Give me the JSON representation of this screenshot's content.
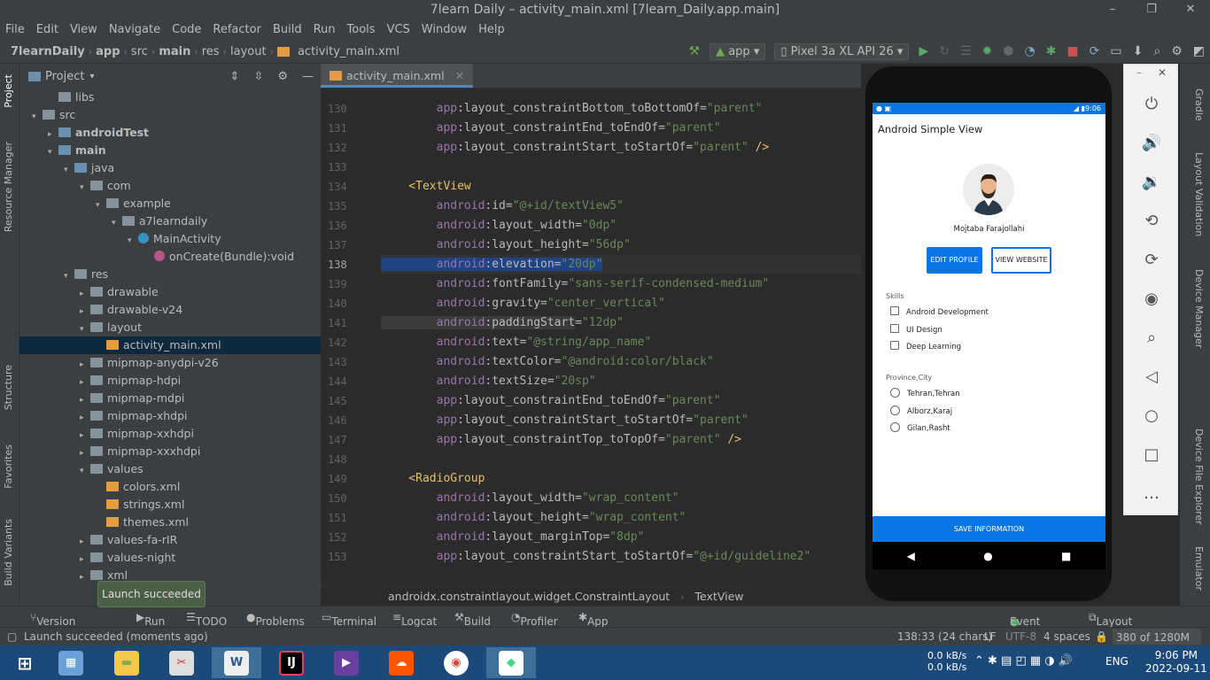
{
  "window": {
    "title": "7learn Daily – activity_main.xml [7learn_Daily.app.main]",
    "minimize": "–",
    "maximize": "❐",
    "close": "✕"
  },
  "menu": [
    "File",
    "Edit",
    "View",
    "Navigate",
    "Code",
    "Refactor",
    "Build",
    "Run",
    "Tools",
    "VCS",
    "Window",
    "Help"
  ],
  "breadcrumbs": [
    "7learnDaily",
    "app",
    "src",
    "main",
    "res",
    "layout",
    "activity_main.xml"
  ],
  "toolbar": {
    "config": "app",
    "device": "Pixel 3a XL API 26"
  },
  "project_panel": {
    "title": "Project",
    "tree": [
      {
        "label": "libs",
        "depth": 3,
        "type": "folder",
        "arrow": ""
      },
      {
        "label": "src",
        "depth": 2,
        "type": "folder",
        "arrow": "▾"
      },
      {
        "label": "androidTest",
        "depth": 3,
        "type": "folder-src",
        "arrow": "▸",
        "bold": true
      },
      {
        "label": "main",
        "depth": 3,
        "type": "folder-src",
        "arrow": "▾",
        "bold": true
      },
      {
        "label": "java",
        "depth": 4,
        "type": "folder-src",
        "arrow": "▾"
      },
      {
        "label": "com",
        "depth": 5,
        "type": "folder",
        "arrow": "▾"
      },
      {
        "label": "example",
        "depth": 6,
        "type": "folder",
        "arrow": "▾"
      },
      {
        "label": "a7learndaily",
        "depth": 7,
        "type": "folder",
        "arrow": "▾"
      },
      {
        "label": "MainActivity",
        "depth": 8,
        "type": "class",
        "arrow": "▾"
      },
      {
        "label": "onCreate(Bundle):void",
        "depth": 9,
        "type": "method",
        "arrow": ""
      },
      {
        "label": "res",
        "depth": 4,
        "type": "folder",
        "arrow": "▾"
      },
      {
        "label": "drawable",
        "depth": 5,
        "type": "folder",
        "arrow": "▸"
      },
      {
        "label": "drawable-v24",
        "depth": 5,
        "type": "folder",
        "arrow": "▸"
      },
      {
        "label": "layout",
        "depth": 5,
        "type": "folder",
        "arrow": "▾"
      },
      {
        "label": "activity_main.xml",
        "depth": 6,
        "type": "xml",
        "arrow": "",
        "selected": true
      },
      {
        "label": "mipmap-anydpi-v26",
        "depth": 5,
        "type": "folder",
        "arrow": "▸"
      },
      {
        "label": "mipmap-hdpi",
        "depth": 5,
        "type": "folder",
        "arrow": "▸"
      },
      {
        "label": "mipmap-mdpi",
        "depth": 5,
        "type": "folder",
        "arrow": "▸"
      },
      {
        "label": "mipmap-xhdpi",
        "depth": 5,
        "type": "folder",
        "arrow": "▸"
      },
      {
        "label": "mipmap-xxhdpi",
        "depth": 5,
        "type": "folder",
        "arrow": "▸"
      },
      {
        "label": "mipmap-xxxhdpi",
        "depth": 5,
        "type": "folder",
        "arrow": "▸"
      },
      {
        "label": "values",
        "depth": 5,
        "type": "folder",
        "arrow": "▾"
      },
      {
        "label": "colors.xml",
        "depth": 6,
        "type": "xml",
        "arrow": ""
      },
      {
        "label": "strings.xml",
        "depth": 6,
        "type": "xml",
        "arrow": ""
      },
      {
        "label": "themes.xml",
        "depth": 6,
        "type": "xml",
        "arrow": ""
      },
      {
        "label": "values-fa-rIR",
        "depth": 5,
        "type": "folder",
        "arrow": "▸"
      },
      {
        "label": "values-night",
        "depth": 5,
        "type": "folder",
        "arrow": "▸"
      },
      {
        "label": "xml",
        "depth": 5,
        "type": "folder",
        "arrow": "▸"
      }
    ]
  },
  "left_tools": [
    "Project",
    "Resource Manager",
    "Structure",
    "Favorites",
    "Build Variants"
  ],
  "right_tools": [
    "Gradle",
    "Layout Validation",
    "Device Manager",
    "Device File Explorer",
    "Emulator"
  ],
  "editor": {
    "tab": "activity_main.xml",
    "lines": [
      {
        "n": "130",
        "segs": [
          [
            "ns",
            "        app"
          ],
          [
            "attr",
            ":layout_constraintBottom_toBottomOf="
          ],
          [
            "val",
            "\"parent\""
          ]
        ]
      },
      {
        "n": "131",
        "segs": [
          [
            "ns",
            "        app"
          ],
          [
            "attr",
            ":layout_constraintEnd_toEndOf="
          ],
          [
            "val",
            "\"parent\""
          ]
        ]
      },
      {
        "n": "132",
        "segs": [
          [
            "ns",
            "        app"
          ],
          [
            "attr",
            ":layout_constraintStart_toStartOf="
          ],
          [
            "val",
            "\"parent\""
          ],
          [
            "tag",
            " />"
          ]
        ]
      },
      {
        "n": "133",
        "segs": []
      },
      {
        "n": "134",
        "segs": [
          [
            "tag",
            "    <TextView"
          ]
        ]
      },
      {
        "n": "135",
        "segs": [
          [
            "ns",
            "        android"
          ],
          [
            "attr",
            ":id="
          ],
          [
            "val",
            "\"@+id/textView5\""
          ]
        ]
      },
      {
        "n": "136",
        "segs": [
          [
            "ns",
            "        android"
          ],
          [
            "attr",
            ":layout_width="
          ],
          [
            "val",
            "\"0dp\""
          ]
        ]
      },
      {
        "n": "137",
        "segs": [
          [
            "ns",
            "        android"
          ],
          [
            "attr",
            ":layout_height="
          ],
          [
            "val",
            "\"56dp\""
          ]
        ]
      },
      {
        "n": "138",
        "cur": true,
        "segs": [
          [
            "ns hl",
            "        android"
          ],
          [
            "attr hl",
            ":elevation="
          ],
          [
            "val hl",
            "\"20dp\""
          ]
        ]
      },
      {
        "n": "139",
        "segs": [
          [
            "ns",
            "        android"
          ],
          [
            "attr",
            ":fontFamily="
          ],
          [
            "val",
            "\"sans-serif-condensed-medium\""
          ]
        ]
      },
      {
        "n": "140",
        "segs": [
          [
            "ns",
            "        android"
          ],
          [
            "attr",
            ":gravity="
          ],
          [
            "val",
            "\"center_vertical\""
          ]
        ]
      },
      {
        "n": "141",
        "segs": [
          [
            "ns hl2",
            "        android"
          ],
          [
            "attr hl2",
            ":paddingStart"
          ],
          [
            "attr",
            "="
          ],
          [
            "val",
            "\"12dp\""
          ]
        ]
      },
      {
        "n": "142",
        "segs": [
          [
            "ns",
            "        android"
          ],
          [
            "attr",
            ":text="
          ],
          [
            "val",
            "\"@string/app_name\""
          ]
        ]
      },
      {
        "n": "143",
        "segs": [
          [
            "ns",
            "        android"
          ],
          [
            "attr",
            ":textColor="
          ],
          [
            "val",
            "\"@android:color/black\""
          ]
        ]
      },
      {
        "n": "144",
        "segs": [
          [
            "ns",
            "        android"
          ],
          [
            "attr",
            ":textSize="
          ],
          [
            "val",
            "\"20sp\""
          ]
        ]
      },
      {
        "n": "145",
        "segs": [
          [
            "ns",
            "        app"
          ],
          [
            "attr",
            ":layout_constraintEnd_toEndOf="
          ],
          [
            "val",
            "\"parent\""
          ]
        ]
      },
      {
        "n": "146",
        "segs": [
          [
            "ns",
            "        app"
          ],
          [
            "attr",
            ":layout_constraintStart_toStartOf="
          ],
          [
            "val",
            "\"parent\""
          ]
        ]
      },
      {
        "n": "147",
        "segs": [
          [
            "ns",
            "        app"
          ],
          [
            "attr",
            ":layout_constraintTop_toTopOf="
          ],
          [
            "val",
            "\"parent\""
          ],
          [
            "tag",
            " />"
          ]
        ]
      },
      {
        "n": "148",
        "segs": []
      },
      {
        "n": "149",
        "segs": [
          [
            "tag",
            "    <RadioGroup"
          ]
        ]
      },
      {
        "n": "150",
        "segs": [
          [
            "ns",
            "        android"
          ],
          [
            "attr",
            ":layout_width="
          ],
          [
            "val",
            "\"wrap_content\""
          ]
        ]
      },
      {
        "n": "151",
        "segs": [
          [
            "ns",
            "        android"
          ],
          [
            "attr",
            ":layout_height="
          ],
          [
            "val",
            "\"wrap_content\""
          ]
        ]
      },
      {
        "n": "152",
        "segs": [
          [
            "ns",
            "        android"
          ],
          [
            "attr",
            ":layout_marginTop="
          ],
          [
            "val",
            "\"8dp\""
          ]
        ]
      },
      {
        "n": "153",
        "segs": [
          [
            "ns",
            "        app"
          ],
          [
            "attr",
            ":layout_constraintStart_toStartOf="
          ],
          [
            "val",
            "\"@+id/guideline2\""
          ]
        ]
      }
    ],
    "breadcrumb": [
      "androidx.constraintlayout.widget.ConstraintLayout",
      "TextView"
    ]
  },
  "phone": {
    "time": "9:06",
    "app_title": "Android Simple View",
    "name": "Mojtaba Farajollahi",
    "edit_btn": "EDIT PROFILE",
    "web_btn": "VIEW WEBSITE",
    "skills_label": "Skills",
    "skills": [
      "Android Development",
      "UI Design",
      "Deep Learning"
    ],
    "province_label": "Province,City",
    "cities": [
      "Tehran,Tehran",
      "Alborz,Karaj",
      "Gilan,Rasht"
    ],
    "save_btn": "SAVE INFORMATION"
  },
  "bottom_tabs": {
    "version_control": "Version Control",
    "run": "Run",
    "todo": "TODO",
    "problems": "Problems",
    "terminal": "Terminal",
    "logcat": "Logcat",
    "build": "Build",
    "profiler": "Profiler",
    "app_inspection": "App Inspection",
    "event_log": "Event Log",
    "layout_inspector": "Layout Inspector"
  },
  "toast": "Launch succeeded",
  "status": {
    "message": "Launch succeeded (moments ago)",
    "position": "138:33 (24 chars)",
    "line_sep": "LF",
    "encoding": "UTF-8",
    "indent": "4 spaces",
    "memory": "380 of 1280M"
  },
  "taskbar": {
    "net_up": "0.0 kB/s",
    "net_down": "0.0 kB/s",
    "lang": "ENG",
    "time": "9:06 PM",
    "date": "2022-09-11"
  },
  "colors": {
    "accent": "#0a76e6",
    "selection": "#0d293e",
    "taskbar": "#1b4a7a"
  }
}
